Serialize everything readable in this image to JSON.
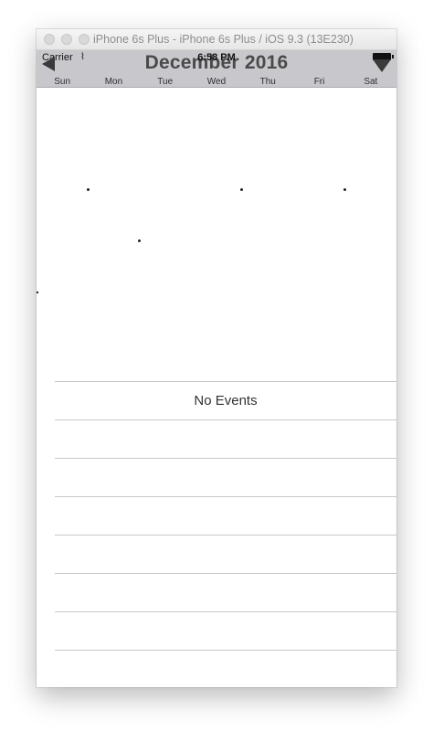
{
  "window": {
    "title": "iPhone 6s Plus - iPhone 6s Plus / iOS 9.3 (13E230)"
  },
  "status_bar": {
    "carrier": "Carrier",
    "wifi_icon": "wifi-icon",
    "time": "6:58 PM",
    "battery_icon": "battery-icon"
  },
  "calendar": {
    "month_title": "December 2016",
    "prev_icon": "prev-month-arrow-icon",
    "next_icon": "next-month-arrow-icon",
    "weekdays": [
      "Sun",
      "Mon",
      "Tue",
      "Wed",
      "Thu",
      "Fri",
      "Sat"
    ],
    "header_color": "#c8c7cc"
  },
  "events": {
    "empty_label": "No Events"
  }
}
